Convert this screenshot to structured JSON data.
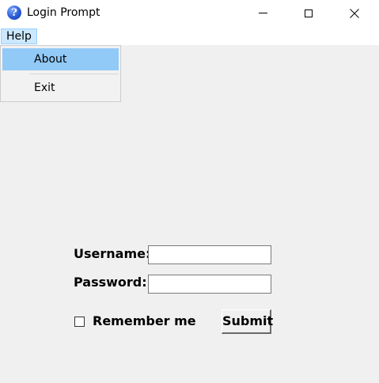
{
  "window": {
    "title": "Login Prompt",
    "icon": "question-icon",
    "icon_glyph": "?",
    "controls": [
      "minimize",
      "maximize",
      "close"
    ]
  },
  "menubar": {
    "items": [
      "Help"
    ]
  },
  "help_menu": {
    "open": true,
    "items": [
      "About",
      "Exit"
    ],
    "highlighted": "About"
  },
  "form": {
    "username_label": "Username:",
    "username_value": "",
    "password_label": "Password:",
    "password_value": "",
    "remember_label": "Remember me",
    "remember_checked": false,
    "submit_label": "Submit"
  },
  "colors": {
    "menu_highlight": "#91c9f7",
    "menubar_active": "#cce8ff",
    "background": "#f0f0f0"
  }
}
